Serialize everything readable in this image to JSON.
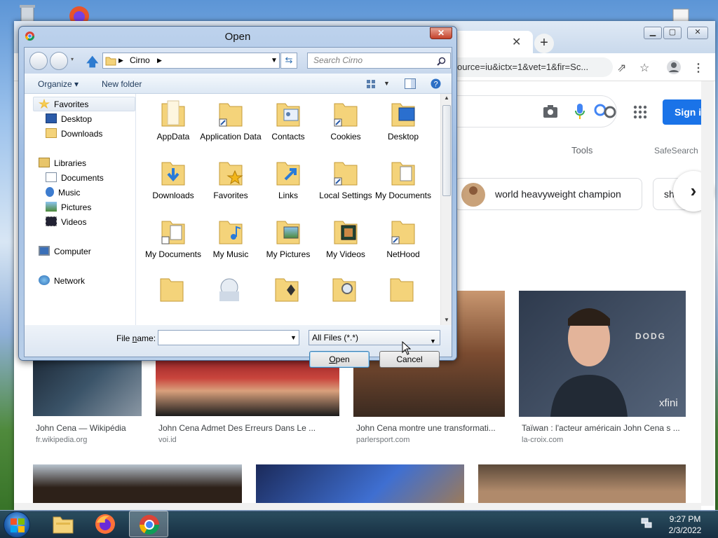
{
  "browser": {
    "address_fragment": "ource=iu&ictx=1&vet=1&fir=Sc...",
    "signin_label": "Sign i",
    "tools_label": "Tools",
    "safesearch_label": "SafeSearch",
    "chips": [
      {
        "label": "world heavyweight champion"
      },
      {
        "label": "sh"
      }
    ],
    "results": [
      {
        "caption": "John Cena — Wikipédia",
        "source": "fr.wikipedia.org"
      },
      {
        "caption": "John Cena Admet Des Erreurs Dans Le ...",
        "source": "voi.id"
      },
      {
        "caption": "John Cena montre une transformati...",
        "source": "parlersport.com"
      },
      {
        "caption": "Taïwan : l'acteur américain John Cena s ...",
        "source": "la-croix.com"
      }
    ],
    "watermark_text": "DODG",
    "xfinity_text": "xfini"
  },
  "dialog": {
    "title": "Open",
    "breadcrumb": "Cirno",
    "search_placeholder": "Search Cirno",
    "organize_label": "Organize",
    "new_folder_label": "New folder",
    "nav": {
      "favorites": "Favorites",
      "desktop": "Desktop",
      "downloads": "Downloads",
      "libraries": "Libraries",
      "documents": "Documents",
      "music": "Music",
      "pictures": "Pictures",
      "videos": "Videos",
      "computer": "Computer",
      "network": "Network"
    },
    "files": [
      "AppData",
      "Application Data",
      "Contacts",
      "Cookies",
      "Desktop",
      "Downloads",
      "Favorites",
      "Links",
      "Local Settings",
      "My Documents",
      "My Documents",
      "My Music",
      "My Pictures",
      "My Videos",
      "NetHood"
    ],
    "filename_label_prefix": "File ",
    "filename_label_accel": "n",
    "filename_label_suffix": "ame:",
    "filename_value": "",
    "filetype_value": "All Files (*.*)",
    "open_accel": "O",
    "open_rest": "pen",
    "cancel_label": "Cancel"
  },
  "taskbar": {
    "time": "9:27 PM",
    "date": "2/3/2022"
  },
  "colors": {
    "google_blue": "#1a73e8",
    "folder_yellow": "#f4d37a"
  }
}
